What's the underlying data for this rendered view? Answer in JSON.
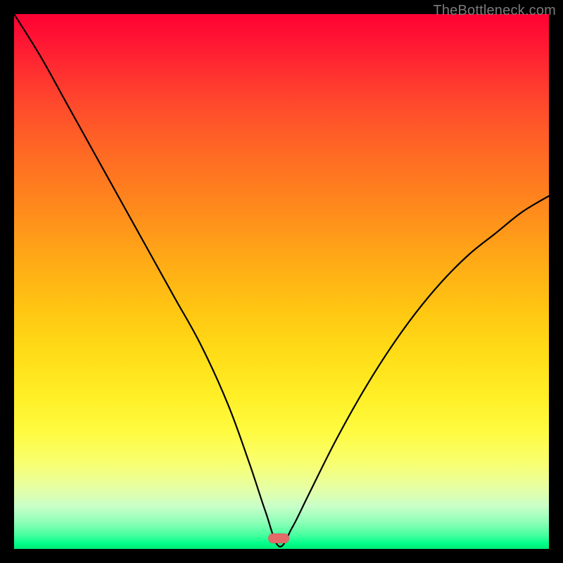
{
  "watermark": {
    "text": "TheBottleneck.com"
  },
  "marker": {
    "x_pct": 49.5,
    "y_pct": 98.0,
    "color": "#e46a6a"
  },
  "chart_data": {
    "type": "line",
    "title": "",
    "xlabel": "",
    "ylabel": "",
    "xlim": [
      0,
      100
    ],
    "ylim": [
      0,
      100
    ],
    "grid": false,
    "legend": false,
    "gradient_stops": [
      {
        "pos": 0,
        "color": "#ff0033"
      },
      {
        "pos": 50,
        "color": "#ffb015"
      },
      {
        "pos": 80,
        "color": "#fffb40"
      },
      {
        "pos": 100,
        "color": "#00e878"
      }
    ],
    "series": [
      {
        "name": "bottleneck-curve",
        "x": [
          0,
          5,
          10,
          15,
          20,
          25,
          30,
          35,
          40,
          44,
          47,
          49.5,
          52,
          55,
          60,
          65,
          70,
          75,
          80,
          85,
          90,
          95,
          100
        ],
        "values": [
          100,
          92,
          83,
          74,
          65,
          56,
          47,
          38,
          27,
          16,
          7,
          0.5,
          4,
          10,
          20,
          29,
          37,
          44,
          50,
          55,
          59,
          63,
          66
        ]
      }
    ],
    "marker_point": {
      "x": 49.5,
      "y": 0.5
    }
  }
}
